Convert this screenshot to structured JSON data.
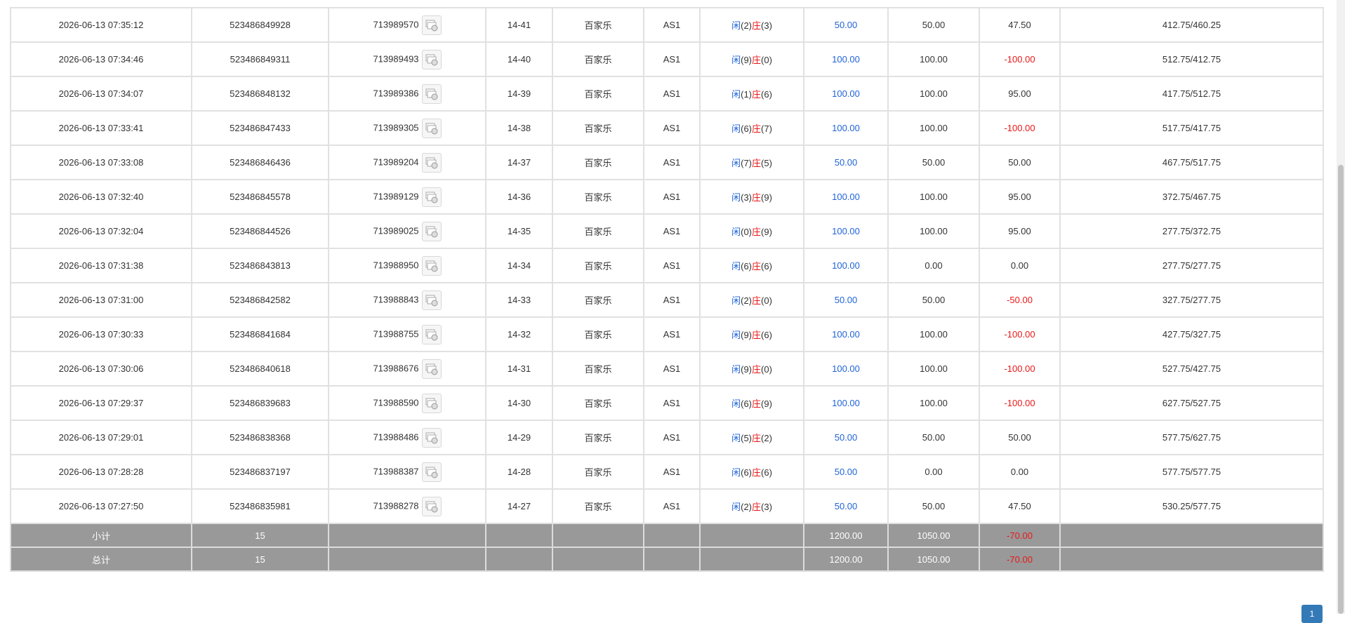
{
  "rows": [
    {
      "time": "2026-06-13 07:35:12",
      "bet_no": "523486849928",
      "game_no": "713989570",
      "round": "14-41",
      "game": "百家乐",
      "table": "AS1",
      "player_label": "闲",
      "player_pts": "(2)",
      "banker_label": "庄",
      "banker_pts": "(3)",
      "bet": "50.00",
      "valid": "50.00",
      "win": "47.50",
      "win_neg": false,
      "balance": "412.75/460.25"
    },
    {
      "time": "2026-06-13 07:34:46",
      "bet_no": "523486849311",
      "game_no": "713989493",
      "round": "14-40",
      "game": "百家乐",
      "table": "AS1",
      "player_label": "闲",
      "player_pts": "(9)",
      "banker_label": "庄",
      "banker_pts": "(0)",
      "bet": "100.00",
      "valid": "100.00",
      "win": "-100.00",
      "win_neg": true,
      "balance": "512.75/412.75"
    },
    {
      "time": "2026-06-13 07:34:07",
      "bet_no": "523486848132",
      "game_no": "713989386",
      "round": "14-39",
      "game": "百家乐",
      "table": "AS1",
      "player_label": "闲",
      "player_pts": "(1)",
      "banker_label": "庄",
      "banker_pts": "(6)",
      "bet": "100.00",
      "valid": "100.00",
      "win": "95.00",
      "win_neg": false,
      "balance": "417.75/512.75"
    },
    {
      "time": "2026-06-13 07:33:41",
      "bet_no": "523486847433",
      "game_no": "713989305",
      "round": "14-38",
      "game": "百家乐",
      "table": "AS1",
      "player_label": "闲",
      "player_pts": "(6)",
      "banker_label": "庄",
      "banker_pts": "(7)",
      "bet": "100.00",
      "valid": "100.00",
      "win": "-100.00",
      "win_neg": true,
      "balance": "517.75/417.75"
    },
    {
      "time": "2026-06-13 07:33:08",
      "bet_no": "523486846436",
      "game_no": "713989204",
      "round": "14-37",
      "game": "百家乐",
      "table": "AS1",
      "player_label": "闲",
      "player_pts": "(7)",
      "banker_label": "庄",
      "banker_pts": "(5)",
      "bet": "50.00",
      "valid": "50.00",
      "win": "50.00",
      "win_neg": false,
      "balance": "467.75/517.75"
    },
    {
      "time": "2026-06-13 07:32:40",
      "bet_no": "523486845578",
      "game_no": "713989129",
      "round": "14-36",
      "game": "百家乐",
      "table": "AS1",
      "player_label": "闲",
      "player_pts": "(3)",
      "banker_label": "庄",
      "banker_pts": "(9)",
      "bet": "100.00",
      "valid": "100.00",
      "win": "95.00",
      "win_neg": false,
      "balance": "372.75/467.75"
    },
    {
      "time": "2026-06-13 07:32:04",
      "bet_no": "523486844526",
      "game_no": "713989025",
      "round": "14-35",
      "game": "百家乐",
      "table": "AS1",
      "player_label": "闲",
      "player_pts": "(0)",
      "banker_label": "庄",
      "banker_pts": "(9)",
      "bet": "100.00",
      "valid": "100.00",
      "win": "95.00",
      "win_neg": false,
      "balance": "277.75/372.75"
    },
    {
      "time": "2026-06-13 07:31:38",
      "bet_no": "523486843813",
      "game_no": "713988950",
      "round": "14-34",
      "game": "百家乐",
      "table": "AS1",
      "player_label": "闲",
      "player_pts": "(6)",
      "banker_label": "庄",
      "banker_pts": "(6)",
      "bet": "100.00",
      "valid": "0.00",
      "win": "0.00",
      "win_neg": false,
      "balance": "277.75/277.75"
    },
    {
      "time": "2026-06-13 07:31:00",
      "bet_no": "523486842582",
      "game_no": "713988843",
      "round": "14-33",
      "game": "百家乐",
      "table": "AS1",
      "player_label": "闲",
      "player_pts": "(2)",
      "banker_label": "庄",
      "banker_pts": "(0)",
      "bet": "50.00",
      "valid": "50.00",
      "win": "-50.00",
      "win_neg": true,
      "balance": "327.75/277.75"
    },
    {
      "time": "2026-06-13 07:30:33",
      "bet_no": "523486841684",
      "game_no": "713988755",
      "round": "14-32",
      "game": "百家乐",
      "table": "AS1",
      "player_label": "闲",
      "player_pts": "(9)",
      "banker_label": "庄",
      "banker_pts": "(6)",
      "bet": "100.00",
      "valid": "100.00",
      "win": "-100.00",
      "win_neg": true,
      "balance": "427.75/327.75"
    },
    {
      "time": "2026-06-13 07:30:06",
      "bet_no": "523486840618",
      "game_no": "713988676",
      "round": "14-31",
      "game": "百家乐",
      "table": "AS1",
      "player_label": "闲",
      "player_pts": "(9)",
      "banker_label": "庄",
      "banker_pts": "(0)",
      "bet": "100.00",
      "valid": "100.00",
      "win": "-100.00",
      "win_neg": true,
      "balance": "527.75/427.75"
    },
    {
      "time": "2026-06-13 07:29:37",
      "bet_no": "523486839683",
      "game_no": "713988590",
      "round": "14-30",
      "game": "百家乐",
      "table": "AS1",
      "player_label": "闲",
      "player_pts": "(6)",
      "banker_label": "庄",
      "banker_pts": "(9)",
      "bet": "100.00",
      "valid": "100.00",
      "win": "-100.00",
      "win_neg": true,
      "balance": "627.75/527.75"
    },
    {
      "time": "2026-06-13 07:29:01",
      "bet_no": "523486838368",
      "game_no": "713988486",
      "round": "14-29",
      "game": "百家乐",
      "table": "AS1",
      "player_label": "闲",
      "player_pts": "(5)",
      "banker_label": "庄",
      "banker_pts": "(2)",
      "bet": "50.00",
      "valid": "50.00",
      "win": "50.00",
      "win_neg": false,
      "balance": "577.75/627.75"
    },
    {
      "time": "2026-06-13 07:28:28",
      "bet_no": "523486837197",
      "game_no": "713988387",
      "round": "14-28",
      "game": "百家乐",
      "table": "AS1",
      "player_label": "闲",
      "player_pts": "(6)",
      "banker_label": "庄",
      "banker_pts": "(6)",
      "bet": "50.00",
      "valid": "0.00",
      "win": "0.00",
      "win_neg": false,
      "balance": "577.75/577.75"
    },
    {
      "time": "2026-06-13 07:27:50",
      "bet_no": "523486835981",
      "game_no": "713988278",
      "round": "14-27",
      "game": "百家乐",
      "table": "AS1",
      "player_label": "闲",
      "player_pts": "(2)",
      "banker_label": "庄",
      "banker_pts": "(3)",
      "bet": "50.00",
      "valid": "50.00",
      "win": "47.50",
      "win_neg": false,
      "balance": "530.25/577.75"
    }
  ],
  "summary": [
    {
      "label": "小计",
      "count": "15",
      "bet": "1200.00",
      "valid": "1050.00",
      "win": "-70.00"
    },
    {
      "label": "总计",
      "count": "15",
      "bet": "1200.00",
      "valid": "1050.00",
      "win": "-70.00"
    }
  ],
  "pagination": {
    "current": "1"
  },
  "icons": {
    "game_detail": "game-detail-icon"
  },
  "colors": {
    "blue": "#1f63d8",
    "red": "#e81818",
    "summary_bg": "#999999",
    "page_btn": "#337ab7"
  }
}
